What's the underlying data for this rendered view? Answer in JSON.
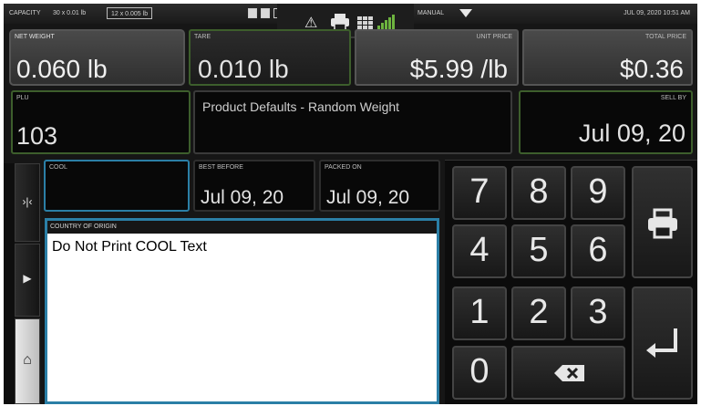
{
  "status_bar": {
    "capacity_label": "CAPACITY",
    "capacity_range1": "30 x 0.01 lb",
    "capacity_range2": "12 x 0.005 lb",
    "mode": "MANUAL",
    "datetime": "JUL 09, 2020 10:51 AM"
  },
  "fields": {
    "net_weight": {
      "label": "NET WEIGHT",
      "value": "0.060 lb"
    },
    "tare": {
      "label": "TARE",
      "value": "0.010 lb"
    },
    "unit_price": {
      "label": "UNIT PRICE",
      "value": "$5.99 /lb"
    },
    "total_price": {
      "label": "TOTAL PRICE",
      "value": "$0.36"
    },
    "plu": {
      "label": "PLU",
      "value": "103"
    },
    "description": {
      "value": "Product Defaults - Random Weight"
    },
    "sell_by": {
      "label": "SELL BY",
      "value": "Jul 09, 20"
    },
    "cool": {
      "label": "COOL",
      "value": ""
    },
    "best_before": {
      "label": "BEST BEFORE",
      "value": "Jul 09, 20"
    },
    "packed_on": {
      "label": "PACKED ON",
      "value": "Jul 09, 20"
    },
    "country_of_origin": {
      "label": "COUNTRY OF ORIGIN",
      "text": "Do Not Print COOL Text"
    }
  },
  "keypad": {
    "digits": [
      "7",
      "8",
      "9",
      "4",
      "5",
      "6",
      "1",
      "2",
      "3",
      "0"
    ]
  },
  "icons": [
    "warning-icon",
    "printer-icon",
    "grid-icon",
    "signal-icon",
    "dropdown-icon",
    "scale-icon",
    "play-icon",
    "home-icon",
    "backspace-icon",
    "enter-icon"
  ],
  "colors": {
    "panel_border_green": "#3d5e2c",
    "panel_border_blue": "#2b7fa6",
    "signal_green": "#6db33f"
  }
}
